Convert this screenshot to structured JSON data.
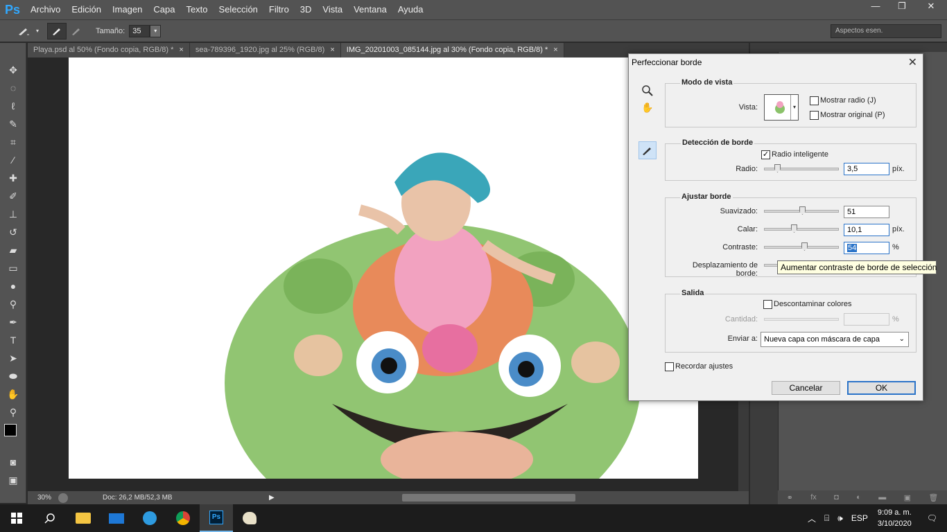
{
  "app": {
    "logo": "Ps",
    "menu": [
      "Archivo",
      "Edición",
      "Imagen",
      "Capa",
      "Texto",
      "Selección",
      "Filtro",
      "3D",
      "Vista",
      "Ventana",
      "Ayuda"
    ],
    "window_controls": {
      "minimize": "—",
      "restore": "❐",
      "close": "✕"
    }
  },
  "options_bar": {
    "size_label": "Tamaño:",
    "size_value": "35",
    "workspace": "Aspectos esen."
  },
  "tabs": [
    {
      "label": "Playa.psd al 50% (Fondo copia, RGB/8) *",
      "close": "×"
    },
    {
      "label": "sea-789396_1920.jpg al 25% (RGB/8)",
      "close": "×"
    },
    {
      "label": "IMG_20201003_085144.jpg al 30% (Fondo copia, RGB/8) *",
      "close": "×"
    }
  ],
  "status": {
    "zoom": "30%",
    "doc": "Doc: 26,2 MB/52,3 MB"
  },
  "dialog": {
    "title": "Perfeccionar borde",
    "close": "✕",
    "vista_group": {
      "title": "Modo de vista",
      "vista_label": "Vista:",
      "mostrar_radio": "Mostrar radio (J)",
      "mostrar_original": "Mostrar original (P)"
    },
    "deteccion_group": {
      "title": "Detección de borde",
      "radio_inteligente": "Radio inteligente",
      "radio_label": "Radio:",
      "radio_value": "3,5",
      "radio_unit": "píx."
    },
    "ajustar_group": {
      "title": "Ajustar borde",
      "suavizado_label": "Suavizado:",
      "suavizado_value": "51",
      "calar_label": "Calar:",
      "calar_value": "10,1",
      "calar_unit": "píx.",
      "contraste_label": "Contraste:",
      "contraste_value": "54",
      "contraste_unit": "%",
      "desplazamiento_label": "Desplazamiento de borde:"
    },
    "tooltip": "Aumentar contraste de borde de selección",
    "salida_group": {
      "title": "Salida",
      "descontaminar": "Descontaminar colores",
      "cantidad_label": "Cantidad:",
      "cantidad_unit": "%",
      "enviar_label": "Enviar a:",
      "enviar_value": "Nueva capa con máscara de capa"
    },
    "recordar": "Recordar ajustes",
    "cancel": "Cancelar",
    "ok": "OK"
  },
  "taskbar": {
    "lang": "ESP",
    "time": "9:09 a. m.",
    "date": "3/10/2020"
  }
}
